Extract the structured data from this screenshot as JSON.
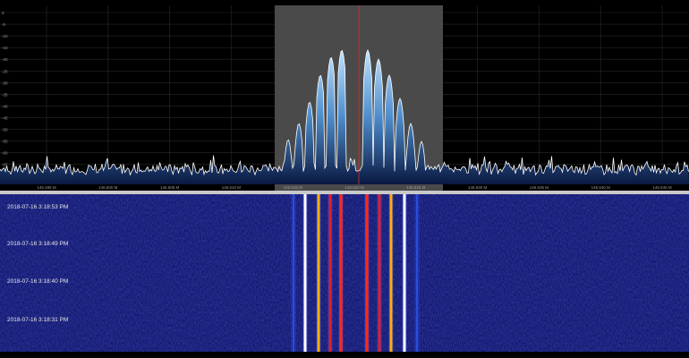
{
  "app": {
    "spectrum": {
      "y_axis_labels": [
        "0",
        "-5",
        "-10",
        "-15",
        "-20",
        "-25",
        "-30",
        "-35",
        "-40",
        "-45",
        "-50",
        "-55",
        "-60",
        "-65",
        "-70"
      ],
      "x_axis_labels": [
        "146.495 M",
        "146.500 M",
        "146.505 M",
        "146.510 M",
        "146.515 M",
        "146.520 M",
        "146.525 M",
        "146.530 M",
        "146.535 M",
        "146.540 M",
        "146.545 M"
      ],
      "background_color": "#000000",
      "filter_highlight_color": "#4a4a4a",
      "center_marker_color": "#d43030",
      "trace_color": "#ffffff",
      "fill_color": "#3a6fb0"
    },
    "waterfall": {
      "timestamps": [
        "2018-07-16 3:18:53 PM",
        "2018-07-16 3:18:49 PM",
        "2018-07-16 3:18:40 PM",
        "2018-07-16 3:18:31 PM"
      ],
      "background_color": "#0b0d5a"
    }
  }
}
